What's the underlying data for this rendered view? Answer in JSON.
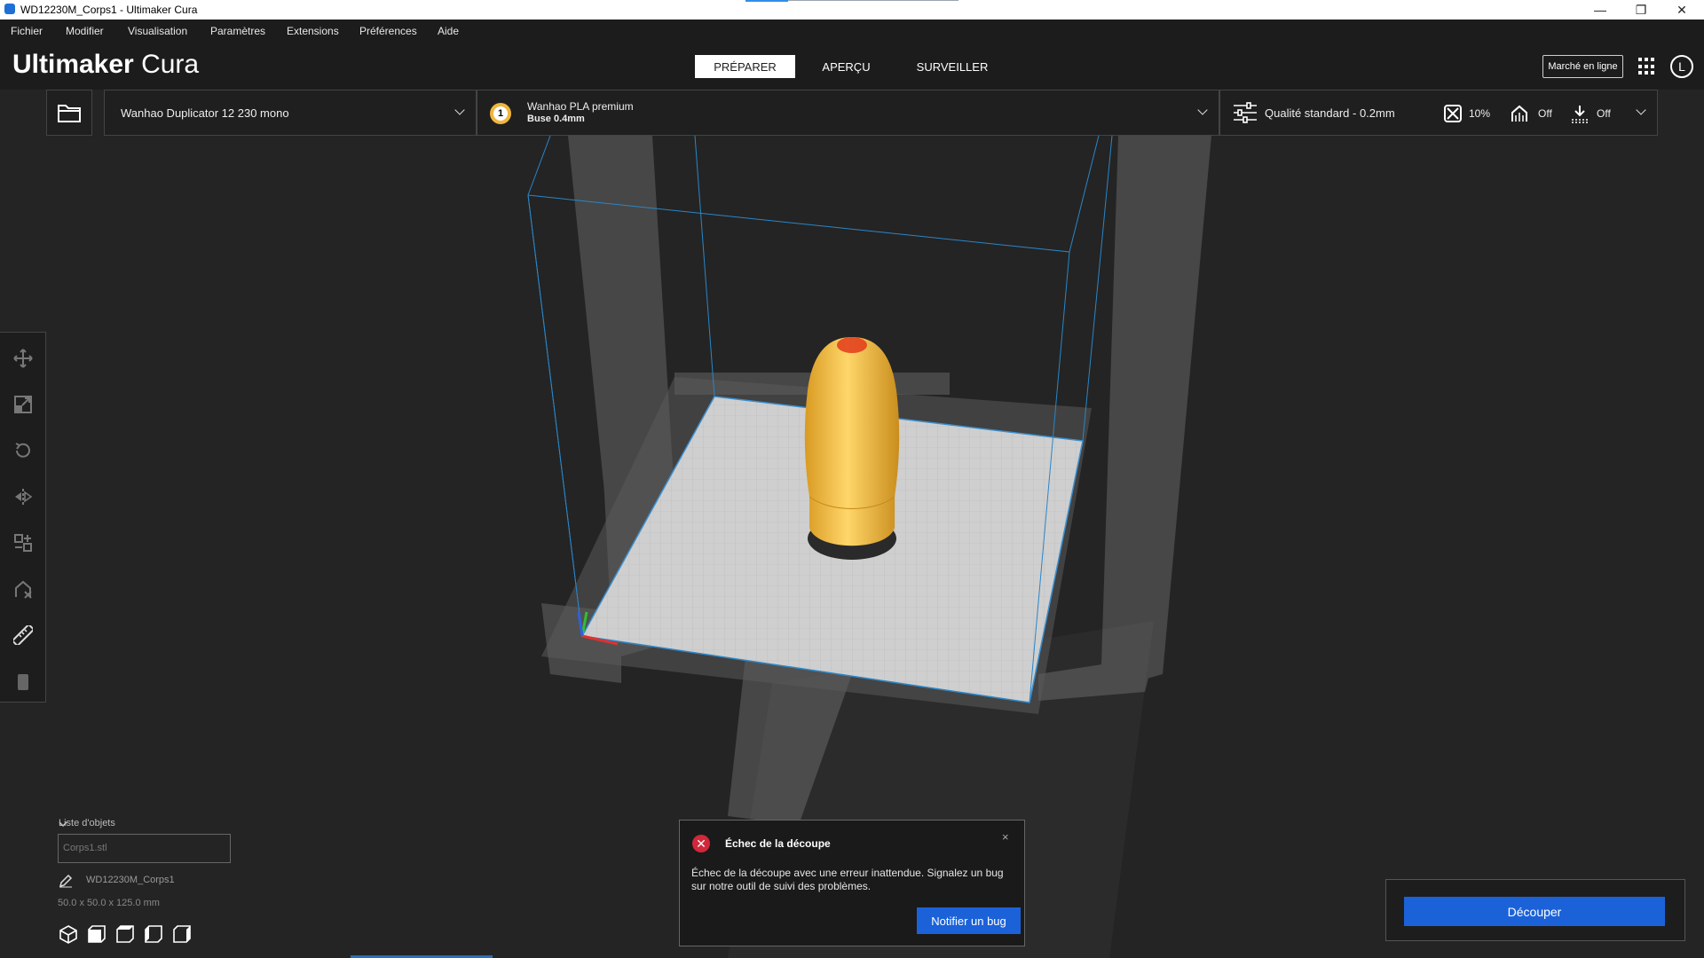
{
  "window": {
    "title": "WD12230M_Corps1 - Ultimaker Cura",
    "controls": {
      "minimize": "—",
      "maximize": "❐",
      "close": "✕"
    }
  },
  "menu": [
    "Fichier",
    "Modifier",
    "Visualisation",
    "Paramètres",
    "Extensions",
    "Préférences",
    "Aide"
  ],
  "header": {
    "logo_bold": "Ultimaker",
    "logo_light": "Cura",
    "tabs": [
      "PRÉPARER",
      "APERÇU",
      "SURVEILLER"
    ],
    "active_tab": "PRÉPARER",
    "marketplace": "Marché en ligne",
    "account_initial": "L"
  },
  "toolbar": {
    "printer": "Wanhao Duplicator 12 230 mono",
    "extruder_number": "1",
    "material": "Wanhao PLA premium",
    "nozzle": "Buse 0.4mm",
    "quality": "Qualité standard - 0.2mm",
    "infill": "10%",
    "support": "Off",
    "adhesion": "Off"
  },
  "tools": [
    "move-icon",
    "scale-icon",
    "rotate-icon",
    "mirror-icon",
    "per-model-settings-icon",
    "support-blocker-icon",
    "measure-icon",
    "trash-icon"
  ],
  "object_list": {
    "title": "Liste d'objets",
    "filter_value": "Corps1.stl",
    "object_name": "WD12230M_Corps1",
    "dimensions": "50.0 x 50.0 x 125.0 mm"
  },
  "notification": {
    "title": "Échec de la découpe",
    "close": "×",
    "body": "Échec de la découpe avec une erreur inattendue. Signalez un bug sur notre outil de suivi des problèmes.",
    "button": "Notifier un bug"
  },
  "slice": {
    "button": "Découper"
  },
  "colors": {
    "accent_blue": "#1b62d9",
    "error_red": "#d2283a",
    "model_yellow": "#f0b63c",
    "background": "#242424"
  }
}
